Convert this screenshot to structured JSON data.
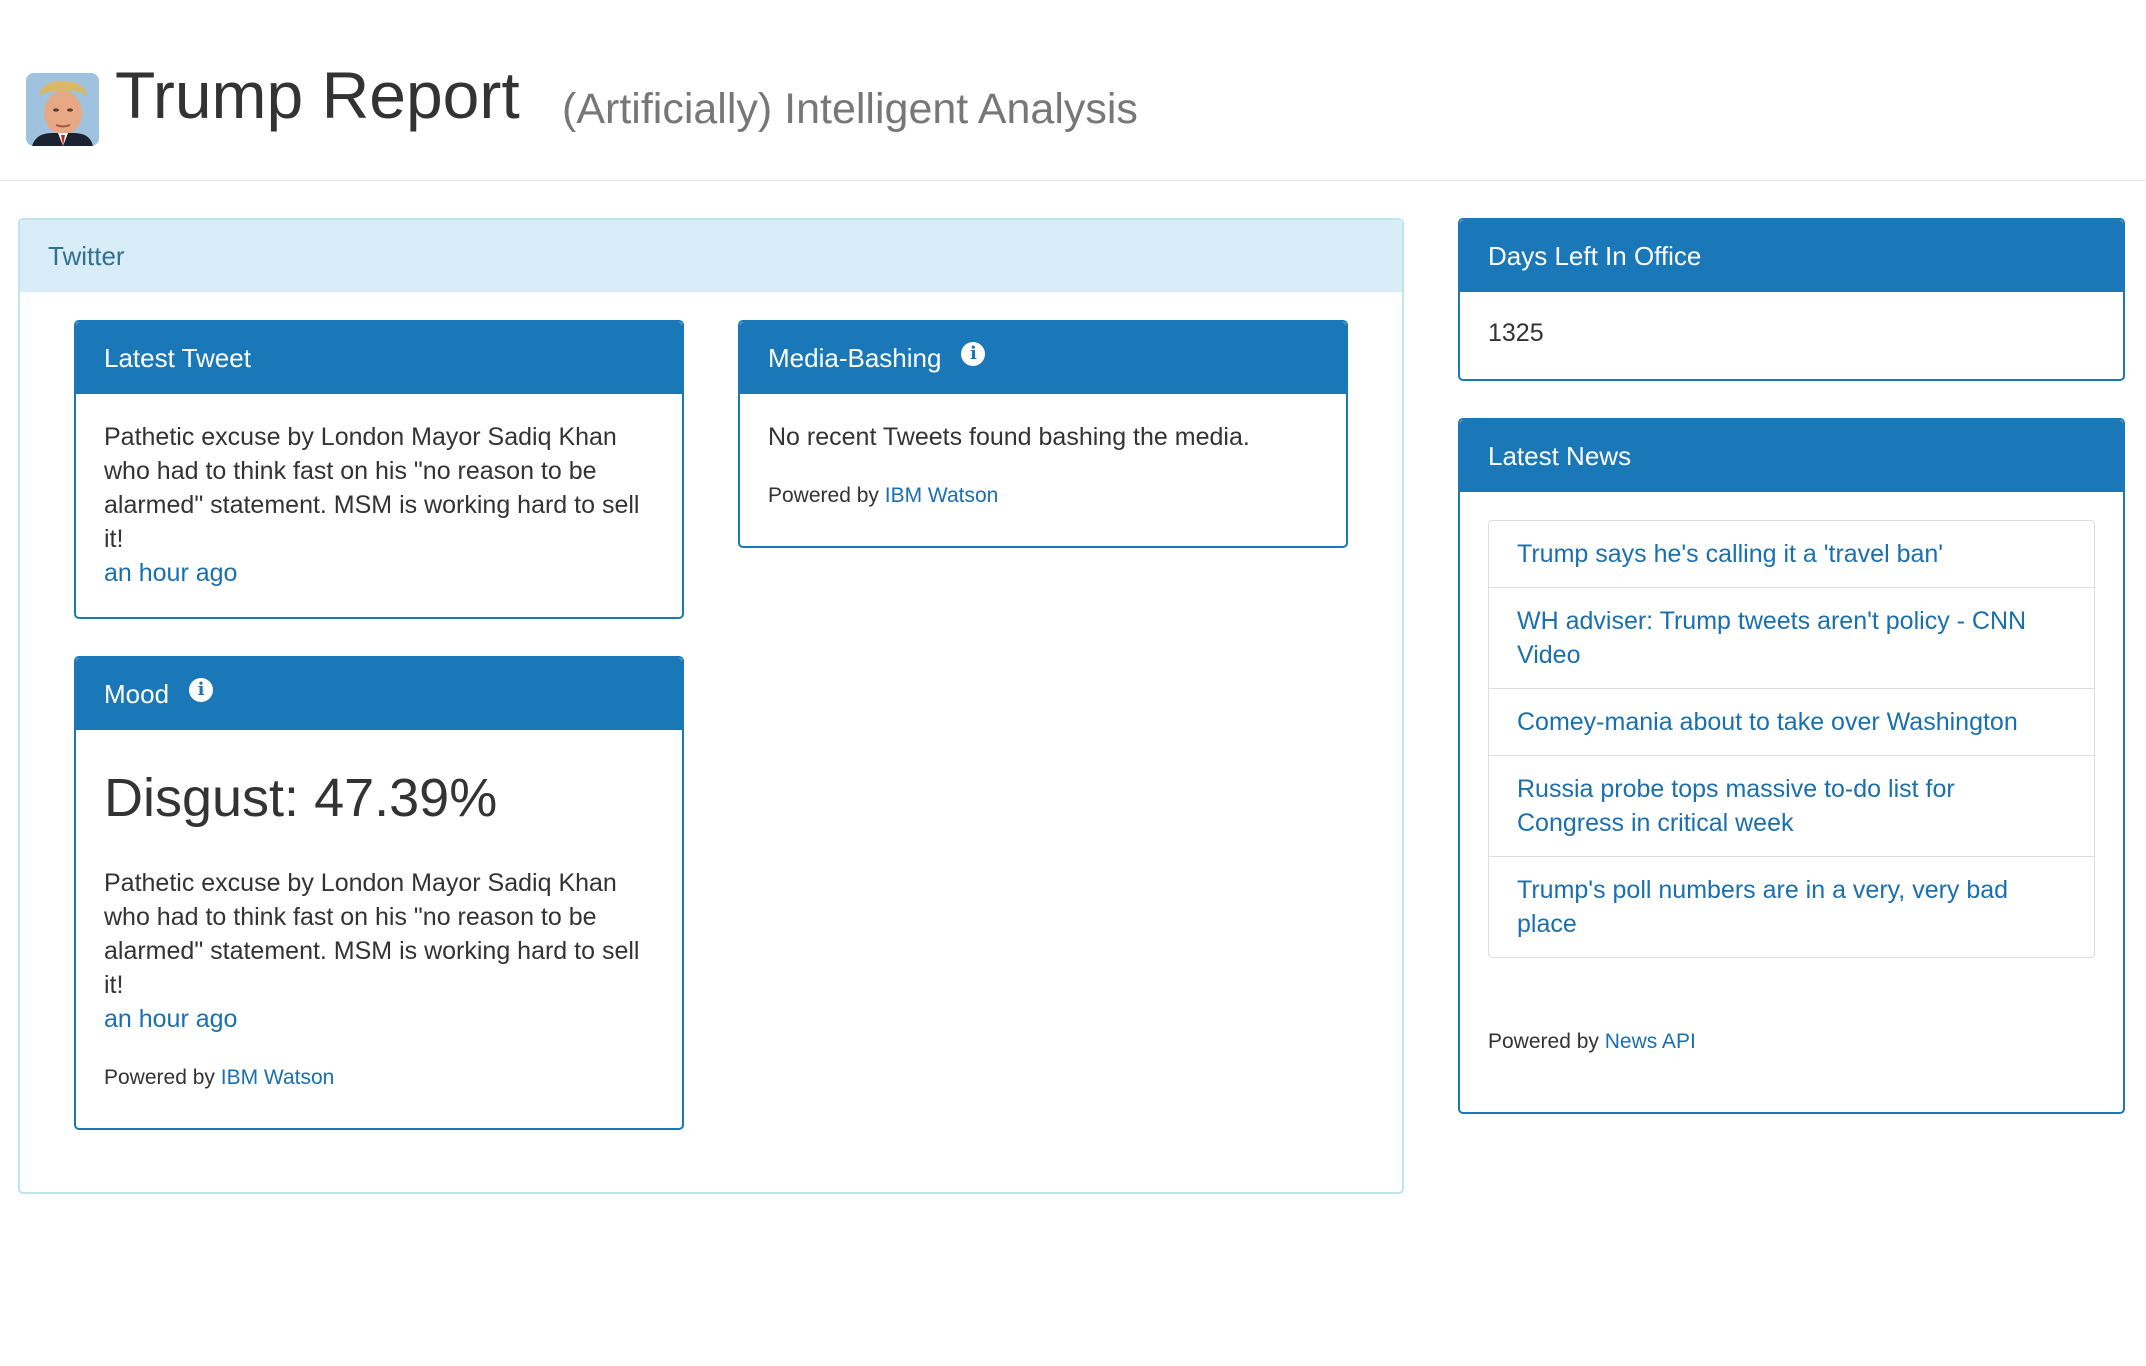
{
  "header": {
    "title": "Trump Report",
    "subtitle": "(Artificially) Intelligent Analysis"
  },
  "twitter": {
    "heading": "Twitter",
    "latest_tweet": {
      "heading": "Latest Tweet",
      "text": "Pathetic excuse by London Mayor Sadiq Khan who had to think fast on his \"no reason to be alarmed\" statement. MSM is working hard to sell it!",
      "time": "an hour ago"
    },
    "media_bashing": {
      "heading": "Media-Bashing",
      "text": "No recent Tweets found bashing the media.",
      "powered_prefix": "Powered by",
      "powered_link": "IBM Watson"
    },
    "mood": {
      "heading": "Mood",
      "value": "Disgust: 47.39%",
      "text": "Pathetic excuse by London Mayor Sadiq Khan who had to think fast on his \"no reason to be alarmed\" statement. MSM is working hard to sell it!",
      "time": "an hour ago",
      "powered_prefix": "Powered by",
      "powered_link": "IBM Watson"
    }
  },
  "days_left": {
    "heading": "Days Left In Office",
    "value": "1325"
  },
  "news": {
    "heading": "Latest News",
    "items": [
      "Trump says he's calling it a 'travel ban'",
      "WH adviser: Trump tweets aren't policy - CNN Video",
      "Comey-mania about to take over Washington",
      "Russia probe tops massive to-do list for Congress in critical week",
      "Trump's poll numbers are in a very, very bad place"
    ],
    "powered_prefix": "Powered by",
    "powered_link": "News API"
  },
  "colors": {
    "primary": "#1a78b8",
    "link": "#1a6fae",
    "info_bg": "#d8edf7",
    "info_border": "#bfe4f1"
  }
}
